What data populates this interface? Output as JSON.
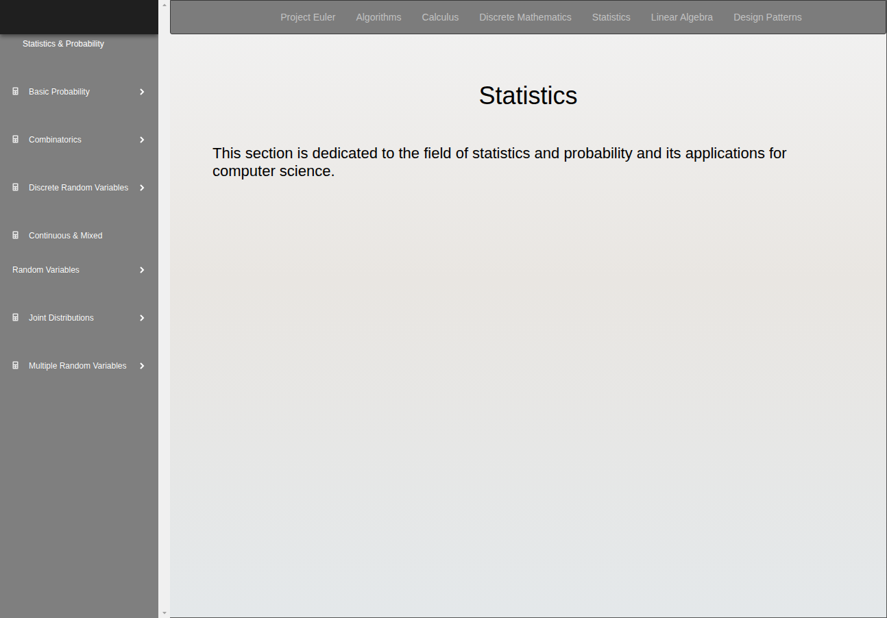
{
  "sidebar": {
    "heading": "Statistics & Probability",
    "items": [
      {
        "label": "Basic Probability"
      },
      {
        "label": "Combinatorics"
      },
      {
        "label": "Discrete Random Variables"
      },
      {
        "label": "Continuous & Mixed Random Variables"
      },
      {
        "label": "Joint Distributions"
      },
      {
        "label": "Multiple Random Variables"
      }
    ]
  },
  "nav": {
    "links": [
      "Project Euler",
      "Algorithms",
      "Calculus",
      "Discrete Mathematics",
      "Statistics",
      "Linear Algebra",
      "Design Patterns"
    ]
  },
  "page": {
    "title": "Statistics",
    "description": "This section is dedicated to the field of statistics and probability and its applications for computer science."
  }
}
